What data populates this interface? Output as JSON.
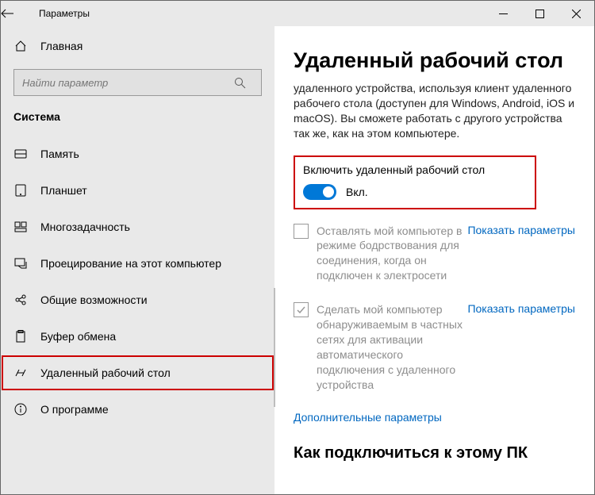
{
  "titlebar": {
    "title": "Параметры"
  },
  "home": {
    "label": "Главная"
  },
  "search": {
    "placeholder": "Найти параметр"
  },
  "section": {
    "header": "Система"
  },
  "sidebar": {
    "items": [
      {
        "label": "Память"
      },
      {
        "label": "Планшет"
      },
      {
        "label": "Многозадачность"
      },
      {
        "label": "Проецирование на этот компьютер"
      },
      {
        "label": "Общие возможности"
      },
      {
        "label": "Буфер обмена"
      },
      {
        "label": "Удаленный рабочий стол"
      },
      {
        "label": "О программе"
      }
    ]
  },
  "content": {
    "title": "Удаленный рабочий стол",
    "desc_partial": "удаленного устройства, используя клиент удаленного рабочего стола (доступен для Windows, Android, iOS и macOS). Вы сможете работать с другого устройства так же, как на этом компьютере.",
    "toggle_title": "Включить удаленный рабочий стол",
    "toggle_state": "Вкл.",
    "opt1_text": "Оставлять мой компьютер в режиме бодрствования для соединения, когда он подключен к электросети",
    "opt1_link": "Показать параметры",
    "opt2_text": "Сделать мой компьютер обнаруживаемым в частных сетях для активации автоматического подключения с удаленного устройства",
    "opt2_link": "Показать параметры",
    "more_link": "Дополнительные параметры",
    "connect_title": "Как подключиться к этому ПК"
  }
}
